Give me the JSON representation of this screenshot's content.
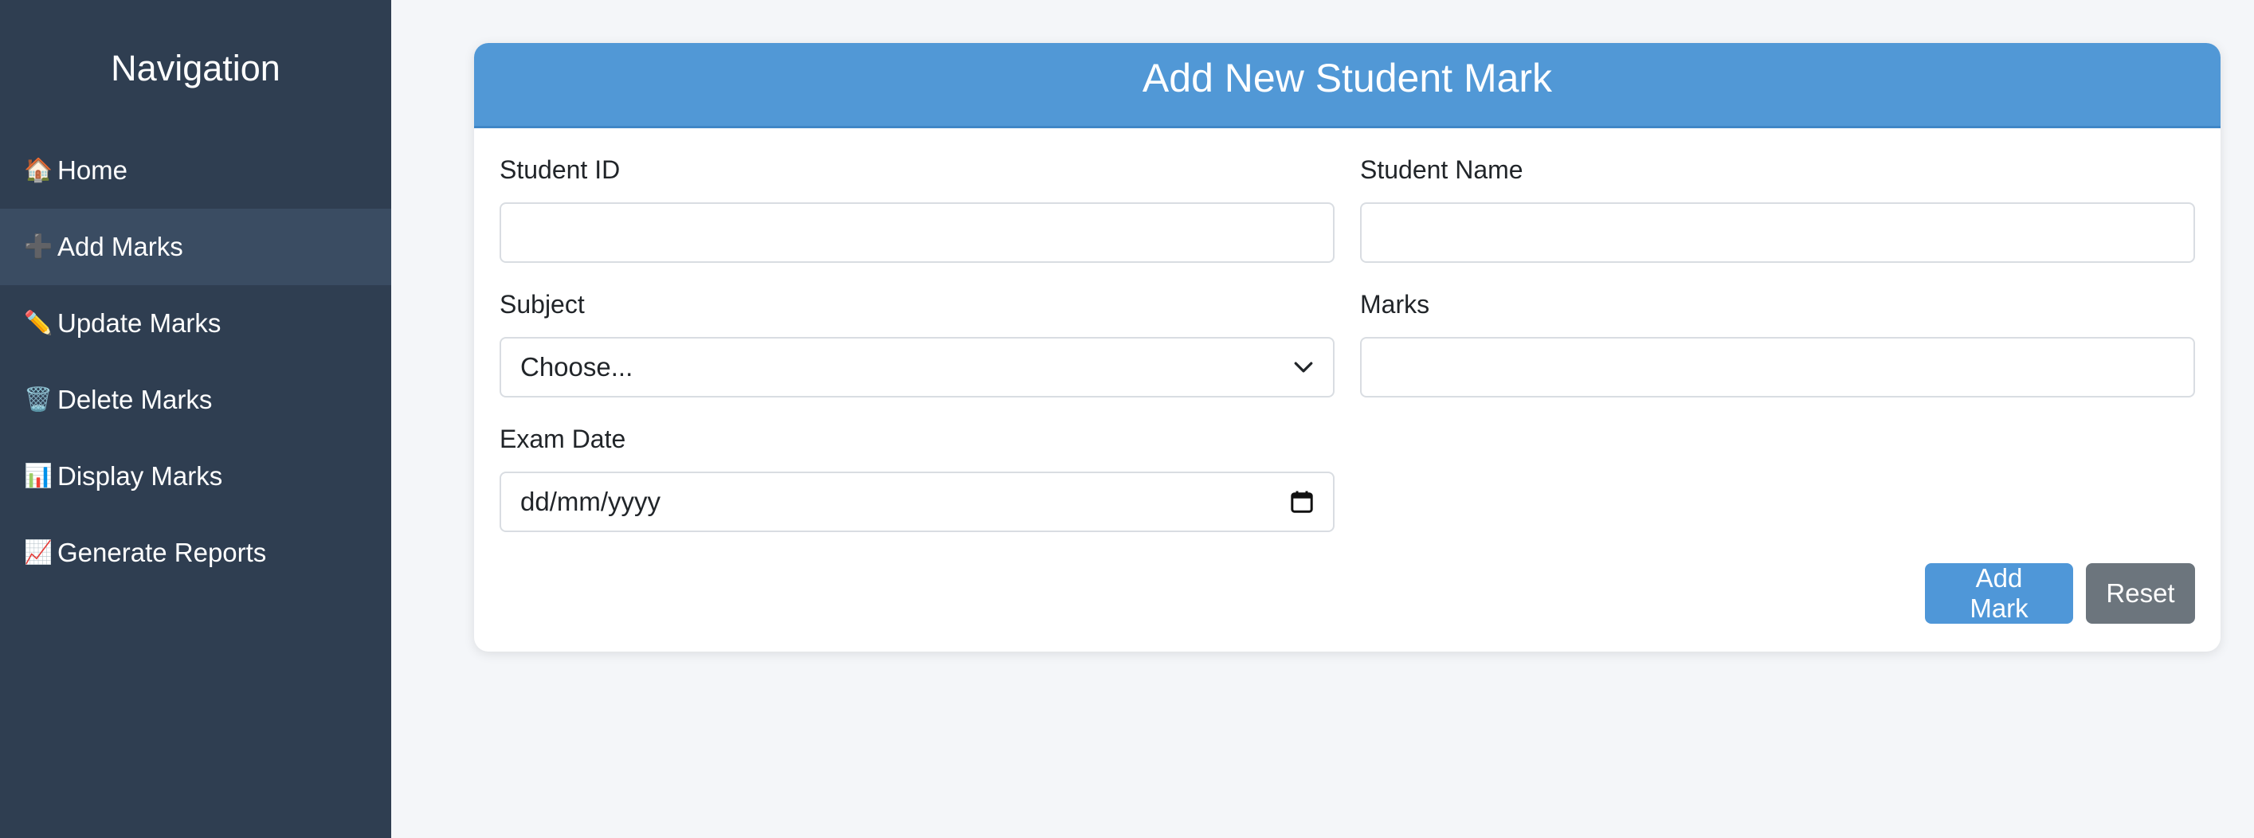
{
  "sidebar": {
    "title": "Navigation",
    "items": [
      {
        "icon": "🏠",
        "icon_name": "home-icon",
        "label": "Home",
        "active": false
      },
      {
        "icon": "➕",
        "icon_name": "plus-icon",
        "label": "Add Marks",
        "active": true
      },
      {
        "icon": "✏️",
        "icon_name": "pencil-icon",
        "label": "Update Marks",
        "active": false
      },
      {
        "icon": "🗑️",
        "icon_name": "trash-icon",
        "label": "Delete Marks",
        "active": false
      },
      {
        "icon": "📊",
        "icon_name": "bar-chart-icon",
        "label": "Display Marks",
        "active": false
      },
      {
        "icon": "📈",
        "icon_name": "trending-chart-icon",
        "label": "Generate Reports",
        "active": false
      }
    ]
  },
  "form": {
    "title": "Add New Student Mark",
    "student_id": {
      "label": "Student ID",
      "value": ""
    },
    "student_name": {
      "label": "Student Name",
      "value": ""
    },
    "subject": {
      "label": "Subject",
      "selected": "Choose..."
    },
    "marks": {
      "label": "Marks",
      "value": ""
    },
    "exam_date": {
      "label": "Exam Date",
      "placeholder": "dd/mm/yyyy"
    },
    "add_button": "Add Mark",
    "reset_button": "Reset"
  },
  "colors": {
    "sidebar_bg": "#2f3e51",
    "sidebar_active": "#3a4c62",
    "header_blue": "#5198d6",
    "primary_button": "#4f97d8",
    "secondary_button": "#6c757d",
    "page_bg": "#f4f6f9"
  }
}
